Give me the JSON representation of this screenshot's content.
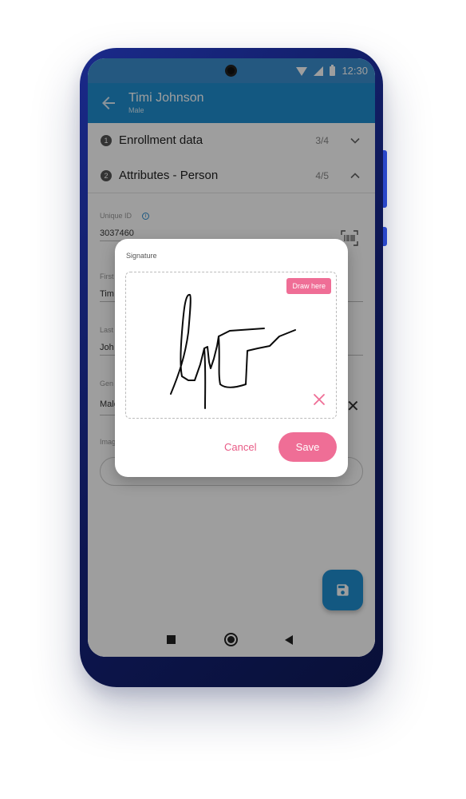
{
  "status_bar": {
    "time": "12:30"
  },
  "app_bar": {
    "title": "Timi Johnson",
    "subtitle": "Male"
  },
  "sections": [
    {
      "number": "1",
      "label": "Enrollment data",
      "count": "3/4",
      "state": "collapsed"
    },
    {
      "number": "2",
      "label": "Attributes - Person",
      "count": "4/5",
      "state": "expanded"
    }
  ],
  "form": {
    "unique_id": {
      "label": "Unique ID",
      "value": "3037460"
    },
    "first_name": {
      "label": "First",
      "value": "Tim"
    },
    "last_name": {
      "label": "Last",
      "value": "Joh"
    },
    "gender": {
      "label": "Gen",
      "value": "Male"
    },
    "image": {
      "label": "Imag"
    }
  },
  "dialog": {
    "title": "Signature",
    "draw_hint": "Draw here",
    "cancel_label": "Cancel",
    "save_label": "Save"
  },
  "colors": {
    "primary": "#1f8fd0",
    "accent": "#ef6e96",
    "status_bar": "#3a8fcf"
  },
  "icons": [
    "back-arrow-icon",
    "wifi-icon",
    "signal-icon",
    "battery-icon",
    "chevron-down-icon",
    "chevron-up-icon",
    "info-icon",
    "barcode-scan-icon",
    "close-icon",
    "save-icon",
    "nav-recents-icon",
    "nav-home-icon",
    "nav-back-icon"
  ]
}
